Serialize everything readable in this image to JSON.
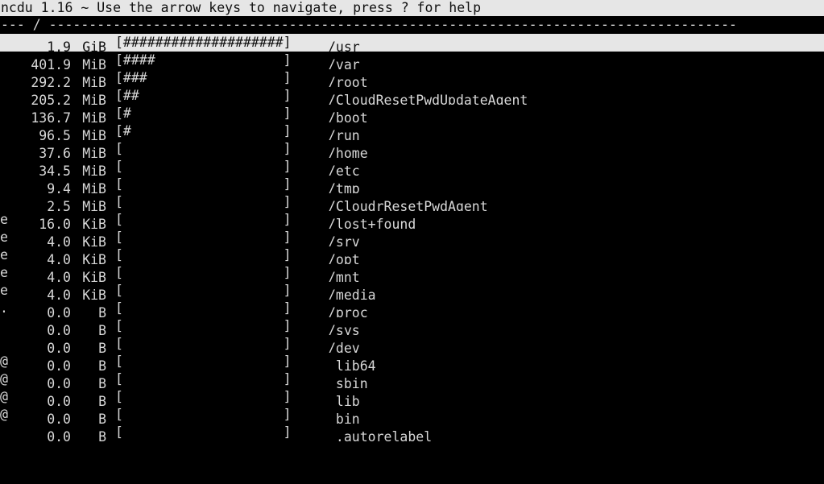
{
  "app": {
    "name": "ncdu",
    "version": "1.16",
    "titlebar": "ncdu 1.16 ~ Use the arrow keys to navigate, press ? for help",
    "help_hint": "press ? for help"
  },
  "colors": {
    "background": "#000000",
    "foreground": "#d8d8d8",
    "titlebar_bg": "#e6e6e6",
    "titlebar_fg": "#101010",
    "selected_bg": "#e6e6e6",
    "selected_fg": "#101010"
  },
  "pathline": {
    "prefix": "--- ",
    "current_path": "/",
    "suffix": " --------------------------------------------------------------------------------------"
  },
  "list": {
    "bar_slots": 20,
    "bar_open": "[",
    "bar_close": "]",
    "selected_index": 0,
    "rows": [
      {
        "flag": "",
        "size": "1.9",
        "unit": "GiB",
        "bar_filled": 20,
        "name": "/usr"
      },
      {
        "flag": "",
        "size": "401.9",
        "unit": "MiB",
        "bar_filled": 4,
        "name": "/var"
      },
      {
        "flag": "",
        "size": "292.2",
        "unit": "MiB",
        "bar_filled": 3,
        "name": "/root"
      },
      {
        "flag": "",
        "size": "205.2",
        "unit": "MiB",
        "bar_filled": 2,
        "name": "/CloudResetPwdUpdateAgent"
      },
      {
        "flag": "",
        "size": "136.7",
        "unit": "MiB",
        "bar_filled": 1,
        "name": "/boot"
      },
      {
        "flag": "",
        "size": "96.5",
        "unit": "MiB",
        "bar_filled": 1,
        "name": "/run"
      },
      {
        "flag": "",
        "size": "37.6",
        "unit": "MiB",
        "bar_filled": 0,
        "name": "/home"
      },
      {
        "flag": "",
        "size": "34.5",
        "unit": "MiB",
        "bar_filled": 0,
        "name": "/etc"
      },
      {
        "flag": "",
        "size": "9.4",
        "unit": "MiB",
        "bar_filled": 0,
        "name": "/tmp"
      },
      {
        "flag": "",
        "size": "2.5",
        "unit": "MiB",
        "bar_filled": 0,
        "name": "/CloudrResetPwdAgent"
      },
      {
        "flag": "e",
        "size": "16.0",
        "unit": "KiB",
        "bar_filled": 0,
        "name": "/lost+found"
      },
      {
        "flag": "e",
        "size": "4.0",
        "unit": "KiB",
        "bar_filled": 0,
        "name": "/srv"
      },
      {
        "flag": "e",
        "size": "4.0",
        "unit": "KiB",
        "bar_filled": 0,
        "name": "/opt"
      },
      {
        "flag": "e",
        "size": "4.0",
        "unit": "KiB",
        "bar_filled": 0,
        "name": "/mnt"
      },
      {
        "flag": "e",
        "size": "4.0",
        "unit": "KiB",
        "bar_filled": 0,
        "name": "/media"
      },
      {
        "flag": ".",
        "size": "0.0",
        "unit": "B",
        "bar_filled": 0,
        "name": "/proc"
      },
      {
        "flag": "",
        "size": "0.0",
        "unit": "B",
        "bar_filled": 0,
        "name": "/sys"
      },
      {
        "flag": "",
        "size": "0.0",
        "unit": "B",
        "bar_filled": 0,
        "name": "/dev"
      },
      {
        "flag": "@",
        "size": "0.0",
        "unit": "B",
        "bar_filled": 0,
        "name": " lib64"
      },
      {
        "flag": "@",
        "size": "0.0",
        "unit": "B",
        "bar_filled": 0,
        "name": " sbin"
      },
      {
        "flag": "@",
        "size": "0.0",
        "unit": "B",
        "bar_filled": 0,
        "name": " lib"
      },
      {
        "flag": "@",
        "size": "0.0",
        "unit": "B",
        "bar_filled": 0,
        "name": " bin"
      },
      {
        "flag": "",
        "size": "0.0",
        "unit": "B",
        "bar_filled": 0,
        "name": " .autorelabel"
      }
    ]
  }
}
